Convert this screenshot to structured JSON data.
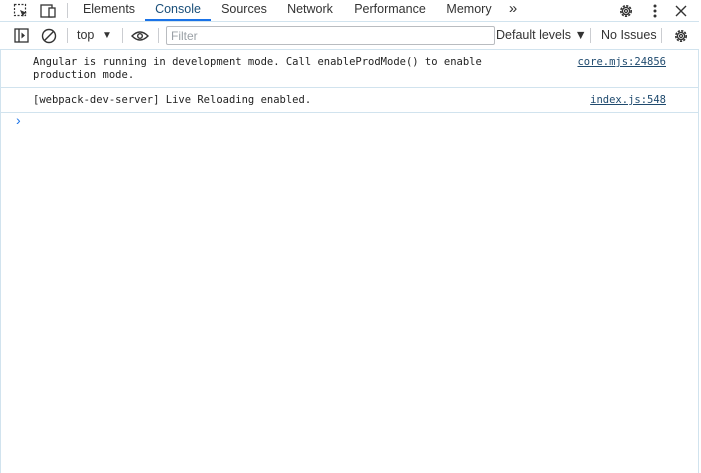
{
  "tabs": [
    {
      "label": "Elements"
    },
    {
      "label": "Console"
    },
    {
      "label": "Sources"
    },
    {
      "label": "Network"
    },
    {
      "label": "Performance"
    },
    {
      "label": "Memory"
    }
  ],
  "more_tabs_label": "»",
  "toolbar": {
    "context": "top",
    "filter_placeholder": "Filter",
    "levels": "Default levels ▼",
    "issues": "No Issues"
  },
  "messages": [
    {
      "text": "Angular is running in development mode. Call enableProdMode() to enable production mode.",
      "source": "core.mjs:24856"
    },
    {
      "text": "[webpack-dev-server] Live Reloading enabled.",
      "source": "index.js:548"
    }
  ],
  "prompt_symbol": "›",
  "icons": {
    "inspect": "inspect-element-icon",
    "device": "device-toolbar-icon",
    "sidebar": "sidebar-toggle-icon",
    "clear": "clear-console-icon",
    "eye": "live-expression-icon",
    "settings": "gear-icon",
    "menu": "kebab-menu-icon",
    "close": "close-icon"
  },
  "colors": {
    "accent": "#1a73e8",
    "active_tab_text": "#1a4f7a",
    "border": "#d1e3ee",
    "link": "#1f4a6e"
  }
}
